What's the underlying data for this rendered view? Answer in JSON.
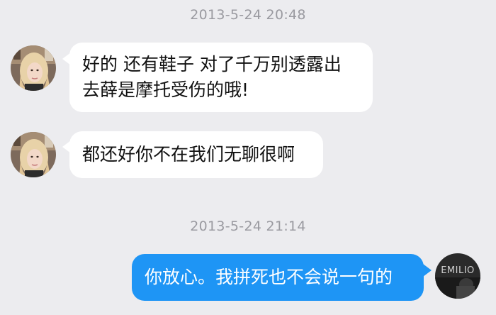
{
  "timestamps": [
    "2013-5-24 20:48",
    "2013-5-24 21:14"
  ],
  "messages": [
    {
      "direction": "incoming",
      "lines": [
        "好的 还有鞋子 对了千万别透露出",
        "去薛是摩托受伤的哦!"
      ]
    },
    {
      "direction": "incoming",
      "lines": [
        "都还好你不在我们无聊很啊"
      ]
    },
    {
      "direction": "outgoing",
      "lines": [
        "你放心。我拼死也不会说一句的"
      ]
    }
  ],
  "self_avatar_text": "EMILIO",
  "colors": {
    "background": "#ececef",
    "incoming_bubble": "#ffffff",
    "outgoing_bubble": "#1e95f5",
    "timestamp_text": "#9a9aa0"
  }
}
